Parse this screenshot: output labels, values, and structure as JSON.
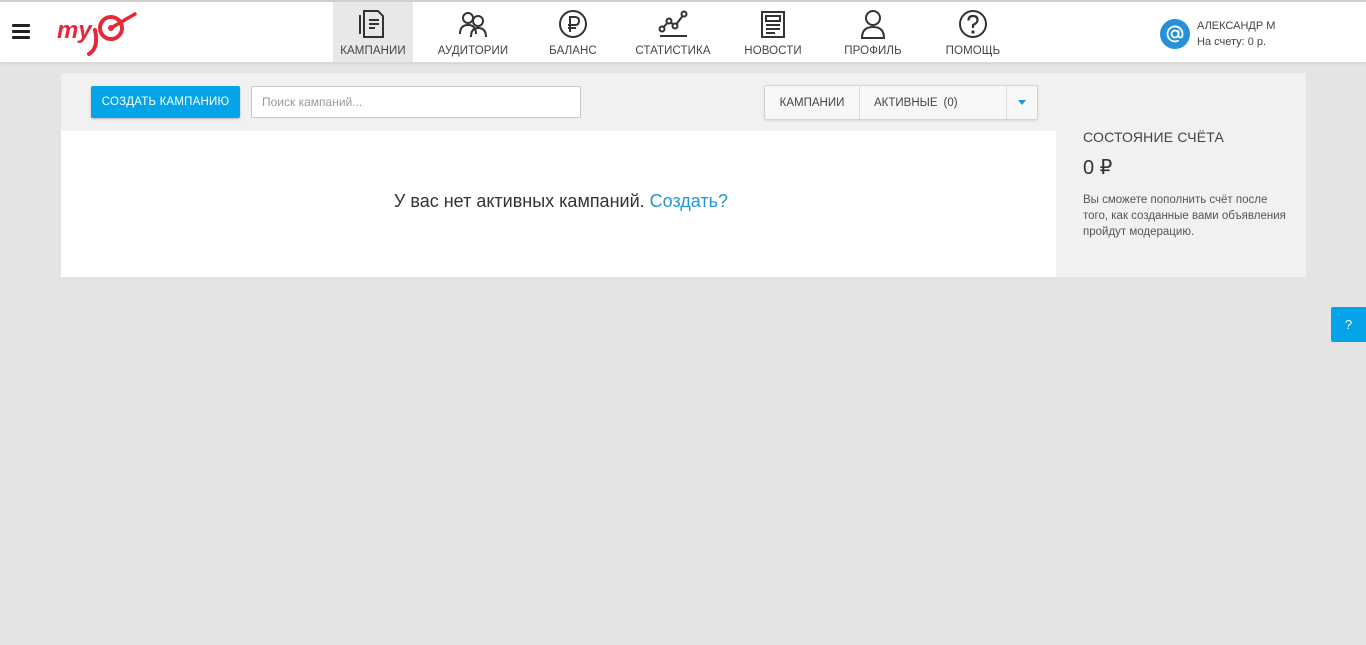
{
  "app": {
    "logo_text": "myTarget",
    "brand_color": "#e5293b",
    "accent_color": "#03a4e8"
  },
  "nav": {
    "items": [
      {
        "label": "КАМПАНИИ",
        "icon": "campaigns-icon",
        "active": true
      },
      {
        "label": "АУДИТОРИИ",
        "icon": "audiences-icon",
        "active": false
      },
      {
        "label": "БАЛАНС",
        "icon": "ruble-icon",
        "active": false
      },
      {
        "label": "СТАТИСТИКА",
        "icon": "statistics-icon",
        "active": false
      },
      {
        "label": "НОВОСТИ",
        "icon": "news-icon",
        "active": false
      },
      {
        "label": "ПРОФИЛЬ",
        "icon": "profile-icon",
        "active": false
      },
      {
        "label": "ПОМОЩЬ",
        "icon": "help-icon",
        "active": false
      }
    ]
  },
  "user": {
    "name": "АЛЕКСАНДР М",
    "balance_text": "На счету: 0 р."
  },
  "toolbar": {
    "create_label": "СОЗДАТЬ КАМПАНИЮ",
    "search_placeholder": "Поиск кампаний...",
    "search_value": "",
    "filter_type": "КАМПАНИИ",
    "filter_status": "АКТИВНЫЕ",
    "filter_count": "(0)"
  },
  "empty_state": {
    "message": "У вас нет активных кампаний.",
    "link": "Создать?"
  },
  "account": {
    "title": "СОСТОЯНИЕ СЧЁТА",
    "value": "0 ₽",
    "note": "Вы сможете пополнить счёт после того, как созданные вами объявления пройдут модерацию."
  },
  "help_tab": {
    "label": "?"
  }
}
